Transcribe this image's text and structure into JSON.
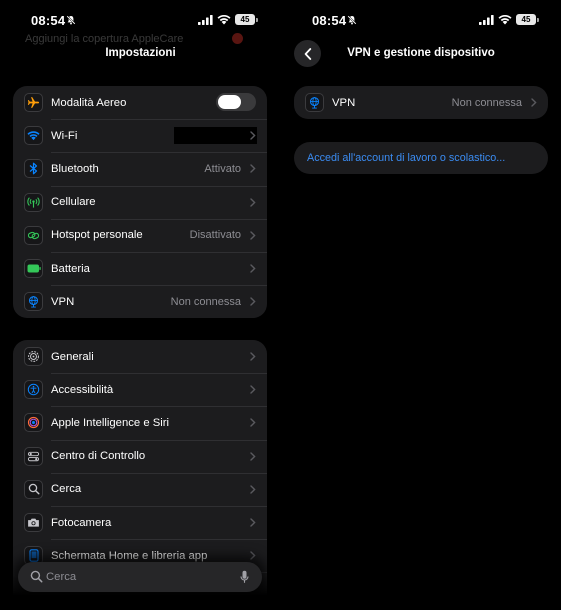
{
  "left": {
    "status": {
      "time": "08:54",
      "battery": "45"
    },
    "banner": {
      "text": "Aggiungi la copertura AppleCare"
    },
    "title": "Impostazioni",
    "groups": [
      {
        "items": [
          {
            "id": "airplane",
            "label": "Modalità Aereo",
            "value": "",
            "control": "toggle",
            "on": false,
            "icon": "airplane-icon"
          },
          {
            "id": "wifi",
            "label": "Wi-Fi",
            "value": "",
            "icon": "wifi-icon"
          },
          {
            "id": "bluetooth",
            "label": "Bluetooth",
            "value": "Attivato",
            "icon": "bluetooth-icon"
          },
          {
            "id": "cellular",
            "label": "Cellulare",
            "value": "",
            "icon": "antenna-icon"
          },
          {
            "id": "hotspot",
            "label": "Hotspot personale",
            "value": "Disattivato",
            "icon": "link-icon"
          },
          {
            "id": "battery",
            "label": "Batteria",
            "value": "",
            "icon": "battery-icon"
          },
          {
            "id": "vpn",
            "label": "VPN",
            "value": "Non connessa",
            "icon": "globe-icon"
          }
        ]
      },
      {
        "items": [
          {
            "id": "general",
            "label": "Generali",
            "icon": "gear-icon"
          },
          {
            "id": "accessibility",
            "label": "Accessibilità",
            "icon": "accessibility-icon"
          },
          {
            "id": "siri",
            "label": "Apple Intelligence e Siri",
            "icon": "siri-icon"
          },
          {
            "id": "control-center",
            "label": "Centro di Controllo",
            "icon": "switches-icon"
          },
          {
            "id": "search",
            "label": "Cerca",
            "icon": "search-icon"
          },
          {
            "id": "camera",
            "label": "Fotocamera",
            "icon": "camera-icon"
          },
          {
            "id": "home-screen",
            "label": "Schermata Home e libreria app",
            "icon": "phone-icon"
          }
        ]
      }
    ],
    "search": {
      "placeholder": "Cerca"
    }
  },
  "right": {
    "status": {
      "time": "08:54",
      "battery": "45"
    },
    "title": "VPN e gestione dispositivo",
    "vpn_row": {
      "label": "VPN",
      "value": "Non connessa",
      "icon": "globe-icon"
    },
    "work_account_link": "Accedi all'account di lavoro o scolastico..."
  },
  "colors": {
    "background": "#000000",
    "cell": "#1c1c1e",
    "secondary_text": "#8d8d93",
    "link": "#3b8cf2",
    "battery_icon": "#34c759"
  }
}
